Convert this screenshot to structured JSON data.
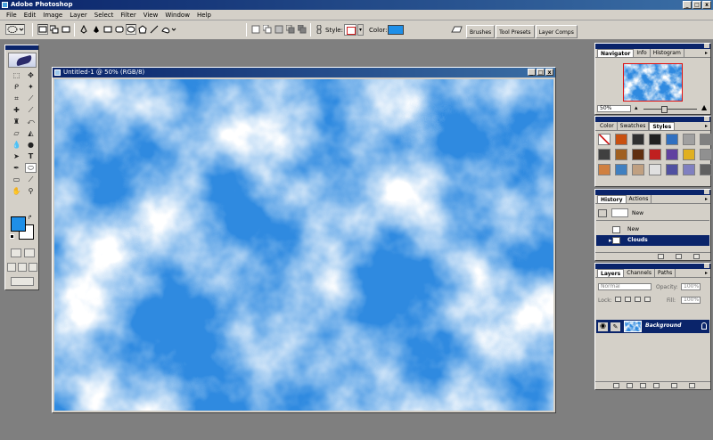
{
  "app": {
    "title": "Adobe Photoshop"
  },
  "window_controls": [
    "_",
    "□",
    "x"
  ],
  "menu": [
    "File",
    "Edit",
    "Image",
    "Layer",
    "Select",
    "Filter",
    "View",
    "Window",
    "Help"
  ],
  "options_bar": {
    "style_label": "Style:",
    "color_label": "Color:",
    "color_value": "#1e8fe8"
  },
  "palette_well": {
    "tabs": [
      "Brushes",
      "Tool Presets",
      "Layer Comps"
    ]
  },
  "toolbox": {
    "foreground_color": "#1e8fe8",
    "background_color": "#ffffff"
  },
  "document": {
    "title": "Untitled-1 @ 50% (RGB/8)",
    "cloud_colors": {
      "sky": "#2f8ae0",
      "cloud": "#ffffff"
    }
  },
  "navigator_panel": {
    "tabs": [
      "Navigator",
      "Info",
      "Histogram"
    ],
    "zoom": "50%"
  },
  "styles_panel": {
    "tabs": [
      "Color",
      "Swatches",
      "Styles"
    ],
    "swatches": [
      "#ffffff",
      "#c85010",
      "#303030",
      "#202020",
      "#3070c0",
      "#a0a0a0",
      "#808080",
      "#404040",
      "#a06020",
      "#603010",
      "#c02020",
      "#6040a0",
      "#e0b020",
      "#909090",
      "#d08040",
      "#4080c0",
      "#c0a080",
      "#e0e0e0",
      "#5050a0",
      "#8080c0",
      "#606060"
    ]
  },
  "history_panel": {
    "tabs": [
      "History",
      "Actions"
    ],
    "snapshot_label": "New",
    "states": [
      {
        "label": "New",
        "selected": false
      },
      {
        "label": "Clouds",
        "selected": true
      }
    ]
  },
  "layers_panel": {
    "tabs": [
      "Layers",
      "Channels",
      "Paths"
    ],
    "blend_mode": "Normal",
    "opacity_label": "Opacity:",
    "opacity_value": "100%",
    "lock_label": "Lock:",
    "fill_label": "Fill:",
    "fill_value": "100%",
    "layers": [
      {
        "name": "Background"
      }
    ]
  }
}
